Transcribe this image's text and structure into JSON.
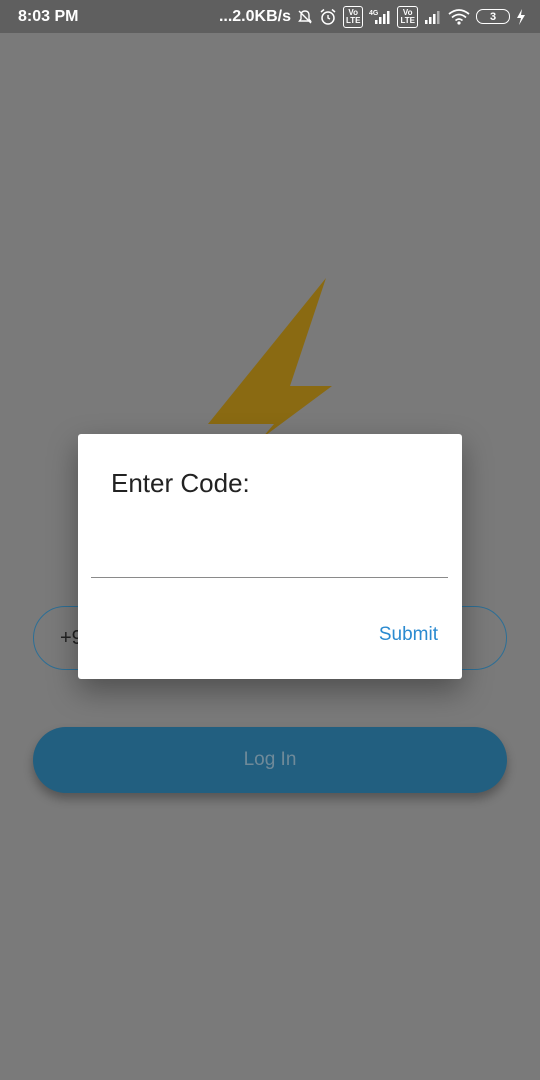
{
  "status_bar": {
    "time": "8:03 PM",
    "net_speed": "...2.0KB/s",
    "volte1": "Vo\nLTE",
    "network_type": "4G",
    "volte2": "Vo\nLTE",
    "battery_level": "3",
    "icons": [
      "bell-off-icon",
      "alarm-icon",
      "volte-icon",
      "signal-icon",
      "volte-icon",
      "signal-icon",
      "wifi-icon",
      "battery-icon",
      "charging-icon"
    ]
  },
  "background": {
    "phone_prefix": "+9",
    "login_label": "Log In",
    "colors": {
      "overlay": "#7a7a7a",
      "bolt": "#8a6a12",
      "button": "#225f80",
      "field_border": "#2d6f96"
    }
  },
  "dialog": {
    "title": "Enter Code:",
    "code_value": "",
    "submit_label": "Submit",
    "colors": {
      "submit": "#2a8ad0"
    }
  }
}
